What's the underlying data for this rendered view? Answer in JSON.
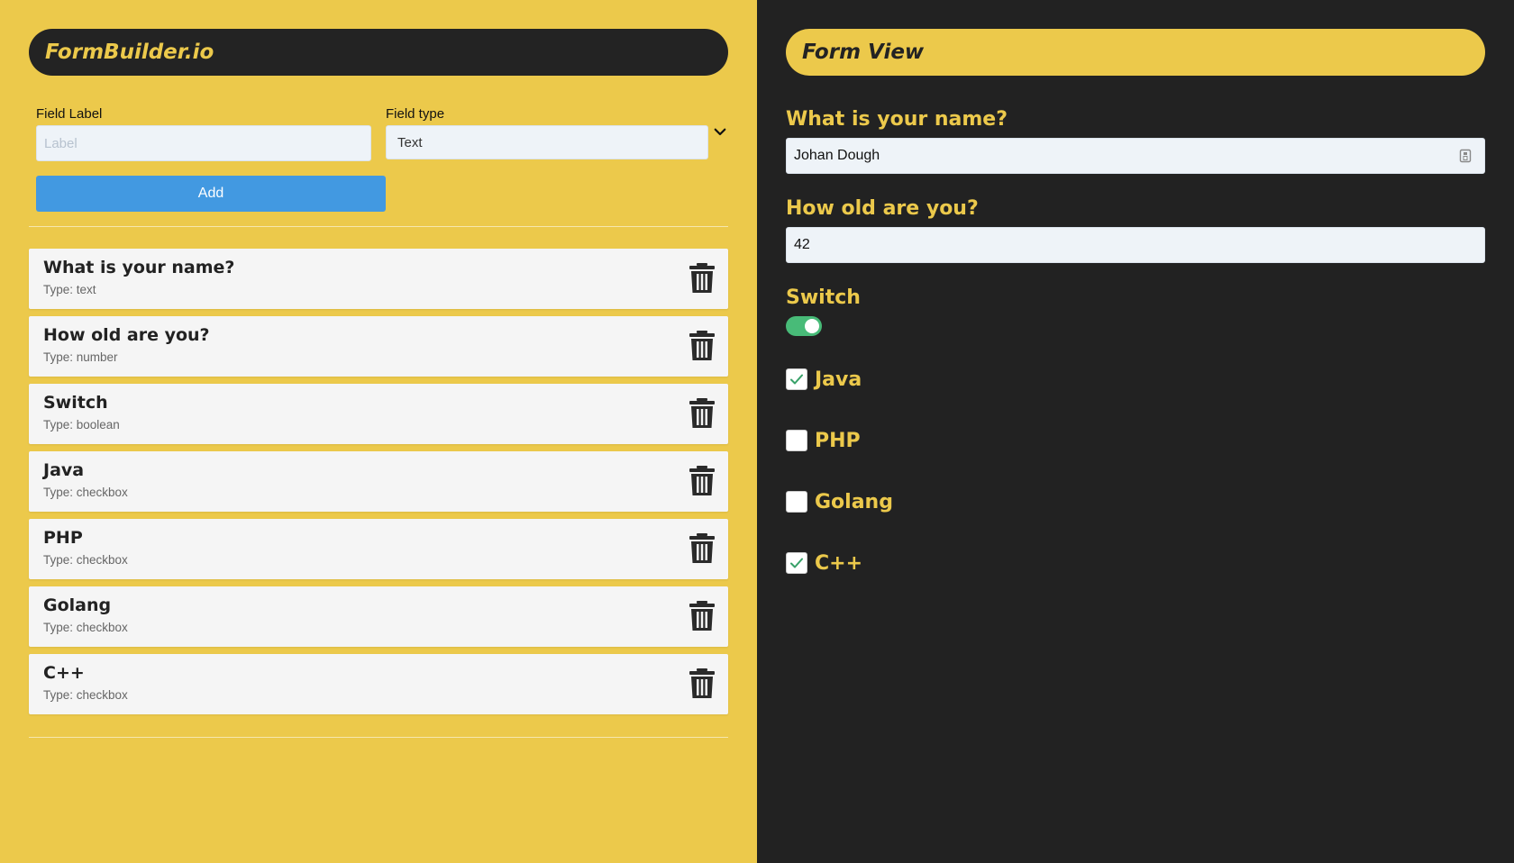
{
  "builder": {
    "app_title": "FormBuilder.io",
    "field_label_label": "Field Label",
    "field_label_placeholder": "Label",
    "field_label_value": "",
    "field_type_label": "Field type",
    "field_type_value": "Text",
    "add_label": "Add",
    "fields": [
      {
        "label": "What is your name?",
        "type": "Type: text"
      },
      {
        "label": "How old are you?",
        "type": "Type: number"
      },
      {
        "label": "Switch",
        "type": "Type: boolean"
      },
      {
        "label": "Java",
        "type": "Type: checkbox"
      },
      {
        "label": "PHP",
        "type": "Type: checkbox"
      },
      {
        "label": "Golang",
        "type": "Type: checkbox"
      },
      {
        "label": "C++",
        "type": "Type: checkbox"
      }
    ]
  },
  "view": {
    "title": "Form View",
    "name_label": "What is your name?",
    "name_value": "Johan Dough",
    "age_label": "How old are you?",
    "age_value": "42",
    "switch_label": "Switch",
    "switch_on": true,
    "checkboxes": [
      {
        "label": "Java",
        "checked": true
      },
      {
        "label": "PHP",
        "checked": false
      },
      {
        "label": "Golang",
        "checked": false
      },
      {
        "label": "C++",
        "checked": true
      }
    ]
  },
  "colors": {
    "accent_yellow": "#ECC94B",
    "dark": "#222222",
    "button_blue": "#4299E1",
    "toggle_green": "#48BB78"
  }
}
